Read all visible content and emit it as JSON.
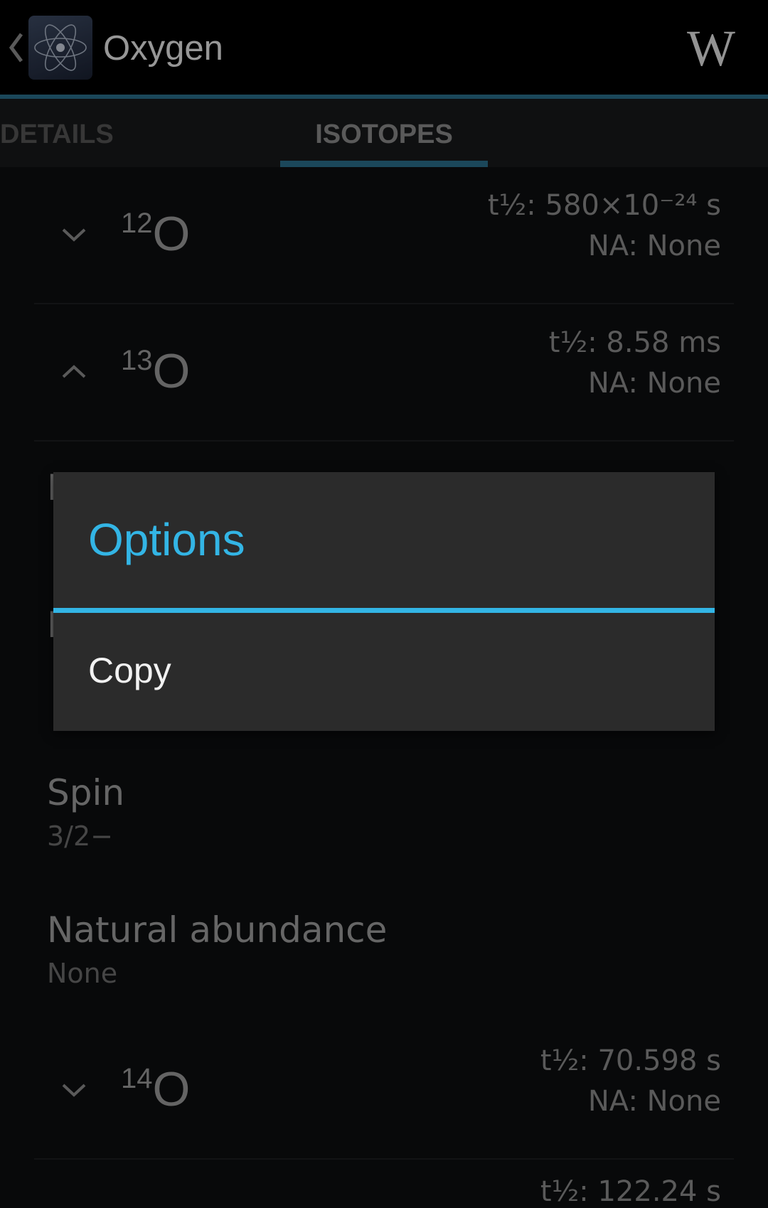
{
  "action_bar": {
    "title": "Oxygen",
    "wiki_glyph": "W"
  },
  "tabs": [
    {
      "label": "DETAILS"
    },
    {
      "label": "ISOTOPES"
    }
  ],
  "isotopes": [
    {
      "mass": "12",
      "element": "O",
      "half_life": "t½: 580×10⁻²⁴ s",
      "abundance": "NA: None",
      "state": "collapsed"
    },
    {
      "mass": "13",
      "element": "O",
      "half_life": "t½: 8.58 ms",
      "abundance": "NA: None",
      "state": "expanded"
    },
    {
      "mass": "14",
      "element": "O",
      "half_life": "t½: 70.598 s",
      "abundance": "NA: None",
      "state": "collapsed"
    }
  ],
  "details": [
    {
      "label": "Spin",
      "value": "3/2−"
    },
    {
      "label": "Natural abundance",
      "value": "None"
    }
  ],
  "partial_next_row": "t½: 122.24 s",
  "dialog": {
    "title": "Options",
    "items": [
      {
        "label": "Copy"
      }
    ]
  },
  "colors": {
    "accent": "#33b5e5",
    "tab_indicator": "#2a6d8a",
    "background": "#0d0e10"
  }
}
